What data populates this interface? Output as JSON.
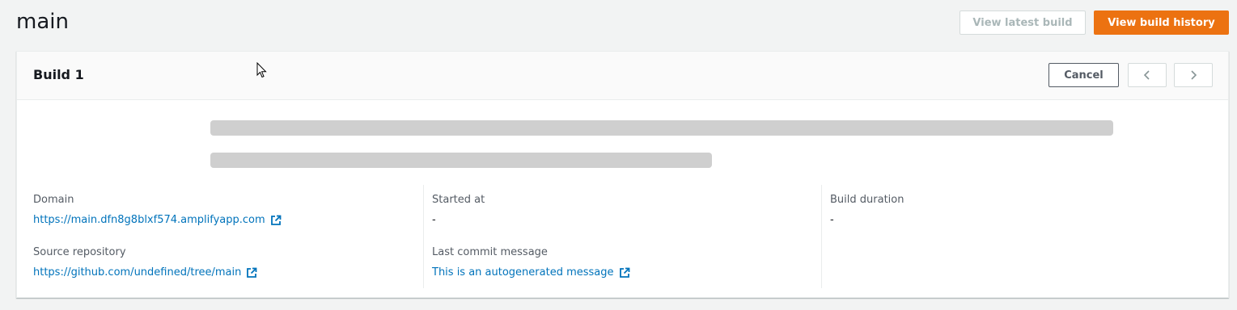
{
  "header": {
    "title": "main",
    "view_latest_label": "View latest build",
    "view_history_label": "View build history"
  },
  "build_card": {
    "title": "Build 1",
    "cancel_label": "Cancel",
    "details": {
      "domain": {
        "label": "Domain",
        "value": "https://main.dfn8g8blxf574.amplifyapp.com"
      },
      "source_repository": {
        "label": "Source repository",
        "value": "https://github.com/undefined/tree/main"
      },
      "started_at": {
        "label": "Started at",
        "value": "-"
      },
      "last_commit_message": {
        "label": "Last commit message",
        "value": "This is an autogenerated message"
      },
      "build_duration": {
        "label": "Build duration",
        "value": "-"
      }
    }
  },
  "icons": {
    "external_link": "external-link-icon",
    "prev": "chevron-left-icon",
    "next": "chevron-right-icon"
  },
  "colors": {
    "primary_button": "#ec7211",
    "link": "#0073bb",
    "skeleton": "#cfcfcf",
    "background": "#f2f3f3"
  }
}
